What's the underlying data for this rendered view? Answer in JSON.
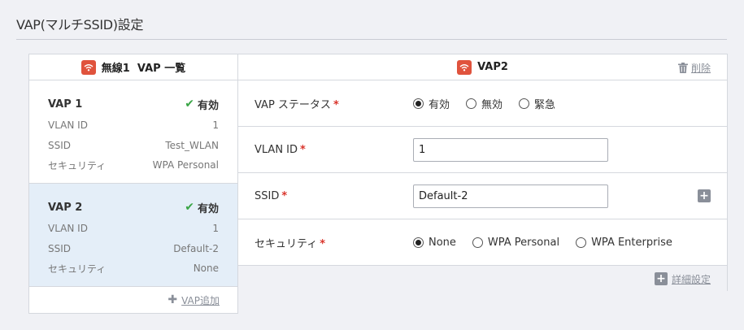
{
  "page": {
    "title": "VAP(マルチSSID)設定"
  },
  "list_panel": {
    "header": "無線1  VAP 一覧",
    "cards": [
      {
        "name": "VAP 1",
        "status": "有効",
        "vlan_label": "VLAN ID",
        "vlan": "1",
        "ssid_label": "SSID",
        "ssid": "Test_WLAN",
        "sec_label": "セキュリティ",
        "security": "WPA Personal"
      },
      {
        "name": "VAP 2",
        "status": "有効",
        "vlan_label": "VLAN ID",
        "vlan": "1",
        "ssid_label": "SSID",
        "ssid": "Default-2",
        "sec_label": "セキュリティ",
        "security": "None"
      }
    ],
    "add_label": "VAP追加"
  },
  "detail": {
    "header": "VAP2",
    "delete_label": "削除",
    "status_label": "VAP ステータス",
    "status_options": [
      "有効",
      "無効",
      "緊急"
    ],
    "status_selected": "有効",
    "vlan_label": "VLAN ID",
    "vlan_value": "1",
    "ssid_label": "SSID",
    "ssid_value": "Default-2",
    "security_label": "セキュリティ",
    "security_options": [
      "None",
      "WPA Personal",
      "WPA Enterprise"
    ],
    "security_selected": "None",
    "advanced_label": "詳細設定"
  },
  "colors": {
    "accent_red": "#e0533d",
    "check_green": "#3aa546",
    "required_red": "#d9342b",
    "selected_bg": "#e4eef8"
  },
  "icons": [
    "wifi-icon",
    "check-icon",
    "plus-icon",
    "trash-icon",
    "plus-square-icon"
  ]
}
